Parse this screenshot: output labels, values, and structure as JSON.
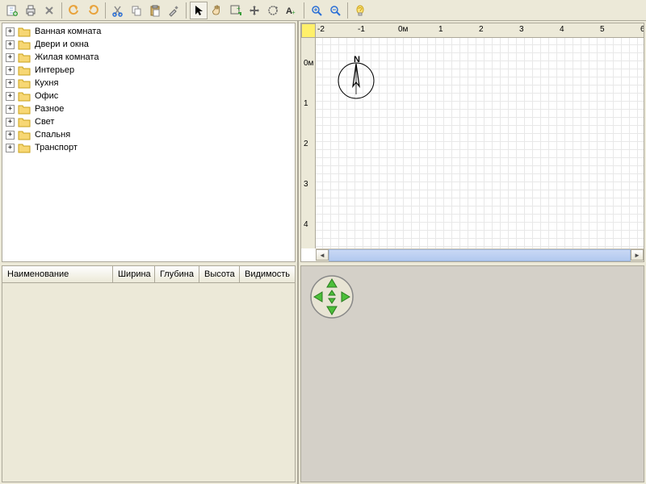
{
  "toolbar": {
    "new": "new",
    "open": "open",
    "prefs": "prefs",
    "undo": "undo",
    "redo": "redo",
    "cut": "cut",
    "copy": "copy",
    "paste": "paste",
    "pick": "pick",
    "pointer": "pointer",
    "pan": "pan",
    "add": "add",
    "move": "move",
    "rotate": "rotate",
    "text": "text",
    "zoomin": "zoomin",
    "zoomout": "zoomout",
    "hint": "hint"
  },
  "tree": {
    "items": [
      "Ванная комната",
      "Двери и окна",
      "Жилая комната",
      "Интерьер",
      "Кухня",
      "Офис",
      "Разное",
      "Свет",
      "Спальня",
      "Транспорт"
    ]
  },
  "table": {
    "columns": [
      "Наименование",
      "Ширина",
      "Глубина",
      "Высота",
      "Видимость"
    ]
  },
  "ruler_h": {
    "labels": [
      "-2",
      "-1",
      "0м",
      "1",
      "2",
      "3",
      "4",
      "5",
      "6"
    ]
  },
  "ruler_v": {
    "labels": [
      "0м",
      "1",
      "2",
      "3",
      "4"
    ]
  },
  "compass": {
    "label": "N"
  }
}
